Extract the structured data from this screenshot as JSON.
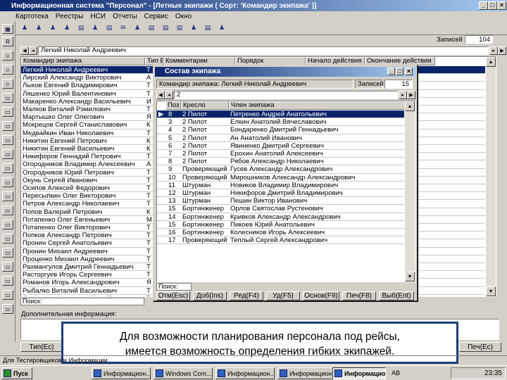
{
  "app": {
    "title": "Информационная система \"Персонал\" - [Летные экипажи ( Сорт: 'Командир экипажа' )]",
    "menu": [
      "Картотека",
      "Реестры",
      "НСИ",
      "Отчеты",
      "Сервис",
      "Окно"
    ],
    "window_controls": [
      "_",
      "□",
      "×"
    ]
  },
  "main": {
    "records_label": "Записей",
    "records_value": "104",
    "current_record": "Легкий Николай Андреевич",
    "columns": [
      "Командир экипажа",
      "Тип ВС",
      "Комментарии",
      "Порядок",
      "Начало действия",
      "Окончание действия"
    ],
    "commanders": [
      {
        "name": "Легкий Николай Андреевич",
        "type": "Т",
        "sel": true
      },
      {
        "name": "Лирский Александр Викторович",
        "type": "А"
      },
      {
        "name": "Лыков Евгений Владимирович",
        "type": "Т"
      },
      {
        "name": "Ляшенко Юрий Валентинович",
        "type": "Т"
      },
      {
        "name": "Макаренко Александр Васильевич",
        "type": "И"
      },
      {
        "name": "Малков Виталий Рэмилович",
        "type": "Т"
      },
      {
        "name": "Мартышко Олег Олегович",
        "type": "Я"
      },
      {
        "name": "Мокрецов Сергей Станиславович",
        "type": "К"
      },
      {
        "name": "Медвайкин Иван Николаевич",
        "type": "Т"
      },
      {
        "name": "Никитин Евгений Петрович",
        "type": "К"
      },
      {
        "name": "Никитин Евгений Васильевич",
        "type": "К"
      },
      {
        "name": "Никифоров Геннадий Петрович",
        "type": "Т"
      },
      {
        "name": "Огородников Владимир Алексеевич",
        "type": "А"
      },
      {
        "name": "Огородников Юрий Петрович",
        "type": "Т"
      },
      {
        "name": "Окунь Сергей Иванович",
        "type": "Т"
      },
      {
        "name": "Осипов Алексей Федорович",
        "type": "Т"
      },
      {
        "name": "Пересыпкин Олег Викторович",
        "type": "Т"
      },
      {
        "name": "Петров Александр Николаевич",
        "type": "Т"
      },
      {
        "name": "Попов Валерий Петрович",
        "type": "К"
      },
      {
        "name": "Потапенко Олег Евгеньевич",
        "type": "М"
      },
      {
        "name": "Потапенко Олег Викторович",
        "type": "Т"
      },
      {
        "name": "Попков Александр Петрович",
        "type": "Т"
      },
      {
        "name": "Пронин Сергей Анатольевич",
        "type": "Т"
      },
      {
        "name": "Пронин Михаил Андреевич",
        "type": "Т"
      },
      {
        "name": "Проценко Михаил Андреевич",
        "type": "Т"
      },
      {
        "name": "Рахмангулов Дмитрий Геннадьевич",
        "type": "Т"
      },
      {
        "name": "Расторгуев Игорь Сергеевич",
        "type": "Т"
      },
      {
        "name": "Романов Игорь Александрович",
        "type": "Я"
      },
      {
        "name": "Рыбалко Виталий Васильевич",
        "type": "Т"
      },
      {
        "name": "Самсонов Александр Михайлович",
        "type": "Т"
      }
    ],
    "search_label": "Поиск:",
    "extra_label": "Дополнительная информация:",
    "btn_filter": "Тип(Ес)",
    "btn_print": "Печ(Ес)"
  },
  "dialog": {
    "title": "Состав экипажа",
    "commander": "Командир экипажа: Легкий Николай Андреевич",
    "records_label": "Записей",
    "records_value": "15",
    "crew_no": "2",
    "columns": [
      "Поз",
      "Кресло",
      "Член экипажа"
    ],
    "crew": [
      {
        "pos": "8",
        "seat": "2 Пилот",
        "member": "Петренко Андрей Анатольевич",
        "sel": true
      },
      {
        "pos": "3",
        "seat": "2 Пилот",
        "member": "Елкин Анатолий Вячеславович"
      },
      {
        "pos": "4",
        "seat": "2 Пилот",
        "member": "Бондаренко Дмитрий Геннадьевич"
      },
      {
        "pos": "5",
        "seat": "2 Пилот",
        "member": "Ан Анатолий Иванович"
      },
      {
        "pos": "6",
        "seat": "2 Пилот",
        "member": "Явиненко Дмитрий Сергеевич"
      },
      {
        "pos": "7",
        "seat": "2 Пилот",
        "member": "Ерохин Анатолий Алексеевич"
      },
      {
        "pos": "8",
        "seat": "2 Пилот",
        "member": "Рябов Александр Николаевич"
      },
      {
        "pos": "9",
        "seat": "Проверяющий",
        "member": "Гусев Александр Александрович"
      },
      {
        "pos": "10",
        "seat": "Проверяющий",
        "member": "Мирошников Александр Александрович"
      },
      {
        "pos": "11",
        "seat": "Штурман",
        "member": "Новиков Владимир Владимирович"
      },
      {
        "pos": "12",
        "seat": "Штурман",
        "member": "Никифоров Дмитрий Владимирович"
      },
      {
        "pos": "13",
        "seat": "Штурман",
        "member": "Пешин Виктор Иванович"
      },
      {
        "pos": "15",
        "seat": "Бортинженер",
        "member": "Орлов Святослав Рустенович"
      },
      {
        "pos": "14",
        "seat": "Бортинженер",
        "member": "Кривков Александр Александрович"
      },
      {
        "pos": "15",
        "seat": "Бортинженер",
        "member": "Пикоев Юрий Анатольевич"
      },
      {
        "pos": "16",
        "seat": "Бортинженер",
        "member": "Колесников Игорь Алексеевич"
      },
      {
        "pos": "17",
        "seat": "Проверяющий",
        "member": "Теплый Сергей Александрович"
      }
    ],
    "search_label": "Поиск:",
    "buttons": [
      "Отм(Esc)",
      "Доб(Ins)",
      "Ред(F4)",
      "Уд(F5)",
      "Основ(F9)",
      "Печ(F8)",
      "Выб(Ent)"
    ],
    "controls": [
      "_",
      "□",
      "×"
    ]
  },
  "caption": {
    "line1": "Для возможности планирования персонала под рейсы,",
    "line2": "имеется возможность определения гибких экипажей."
  },
  "status": "Для Тестировщиков и Информации",
  "taskbar": {
    "start": "Пуск",
    "items": [
      "Информацион...",
      "Windows Com...",
      "Информацион...",
      "Информацион...",
      "Информацион..."
    ],
    "lang": "АВ",
    "time": "23:35"
  }
}
